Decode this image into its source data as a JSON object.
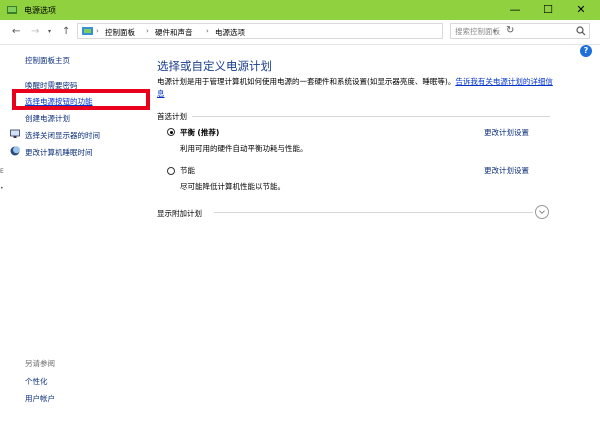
{
  "window": {
    "title": "电源选项",
    "minimize_glyph": "—",
    "maximize_glyph": "☐",
    "close_glyph": "✕"
  },
  "nav": {
    "back_glyph": "←",
    "forward_glyph": "→",
    "up_glyph": "↑",
    "breadcrumb": [
      "控制面板",
      "硬件和声音",
      "电源选项"
    ],
    "breadcrumb_separator": "›",
    "search_placeholder": "搜索控制面板"
  },
  "sidebar": {
    "home": "控制面板主页",
    "items": [
      {
        "label": "唤醒时需要密码",
        "icon": null,
        "active": false
      },
      {
        "label": "选择电源按钮的功能",
        "icon": null,
        "active": true
      },
      {
        "label": "创建电源计划",
        "icon": null,
        "active": false
      },
      {
        "label": "选择关闭显示器的时间",
        "icon": "monitor-icon",
        "active": false
      },
      {
        "label": "更改计算机睡眠时间",
        "icon": "moon-icon",
        "active": false
      }
    ],
    "see_also_title": "另请参阅",
    "see_also": [
      "个性化",
      "用户帐户"
    ]
  },
  "main": {
    "title": "选择或自定义电源计划",
    "description": "电源计划是用于管理计算机如何使用电源的一套硬件和系统设置(如显示器亮度、睡眠等)。",
    "description_link": "告诉我有关电源计划的详细信息",
    "preferred_label": "首选计划",
    "plans": [
      {
        "name": "平衡",
        "tag": "(推荐)",
        "desc": "利用可用的硬件自动平衡功耗与性能。",
        "link": "更改计划设置",
        "selected": true
      },
      {
        "name": "节能",
        "tag": "",
        "desc": "尽可能降低计算机性能以节能。",
        "link": "更改计划设置",
        "selected": false
      }
    ],
    "show_more_label": "显示附加计划"
  },
  "colors": {
    "titlebar": "#8fd13f",
    "highlight": "#e8001c",
    "link": "#0033cc",
    "heading": "#1a3e8c"
  }
}
